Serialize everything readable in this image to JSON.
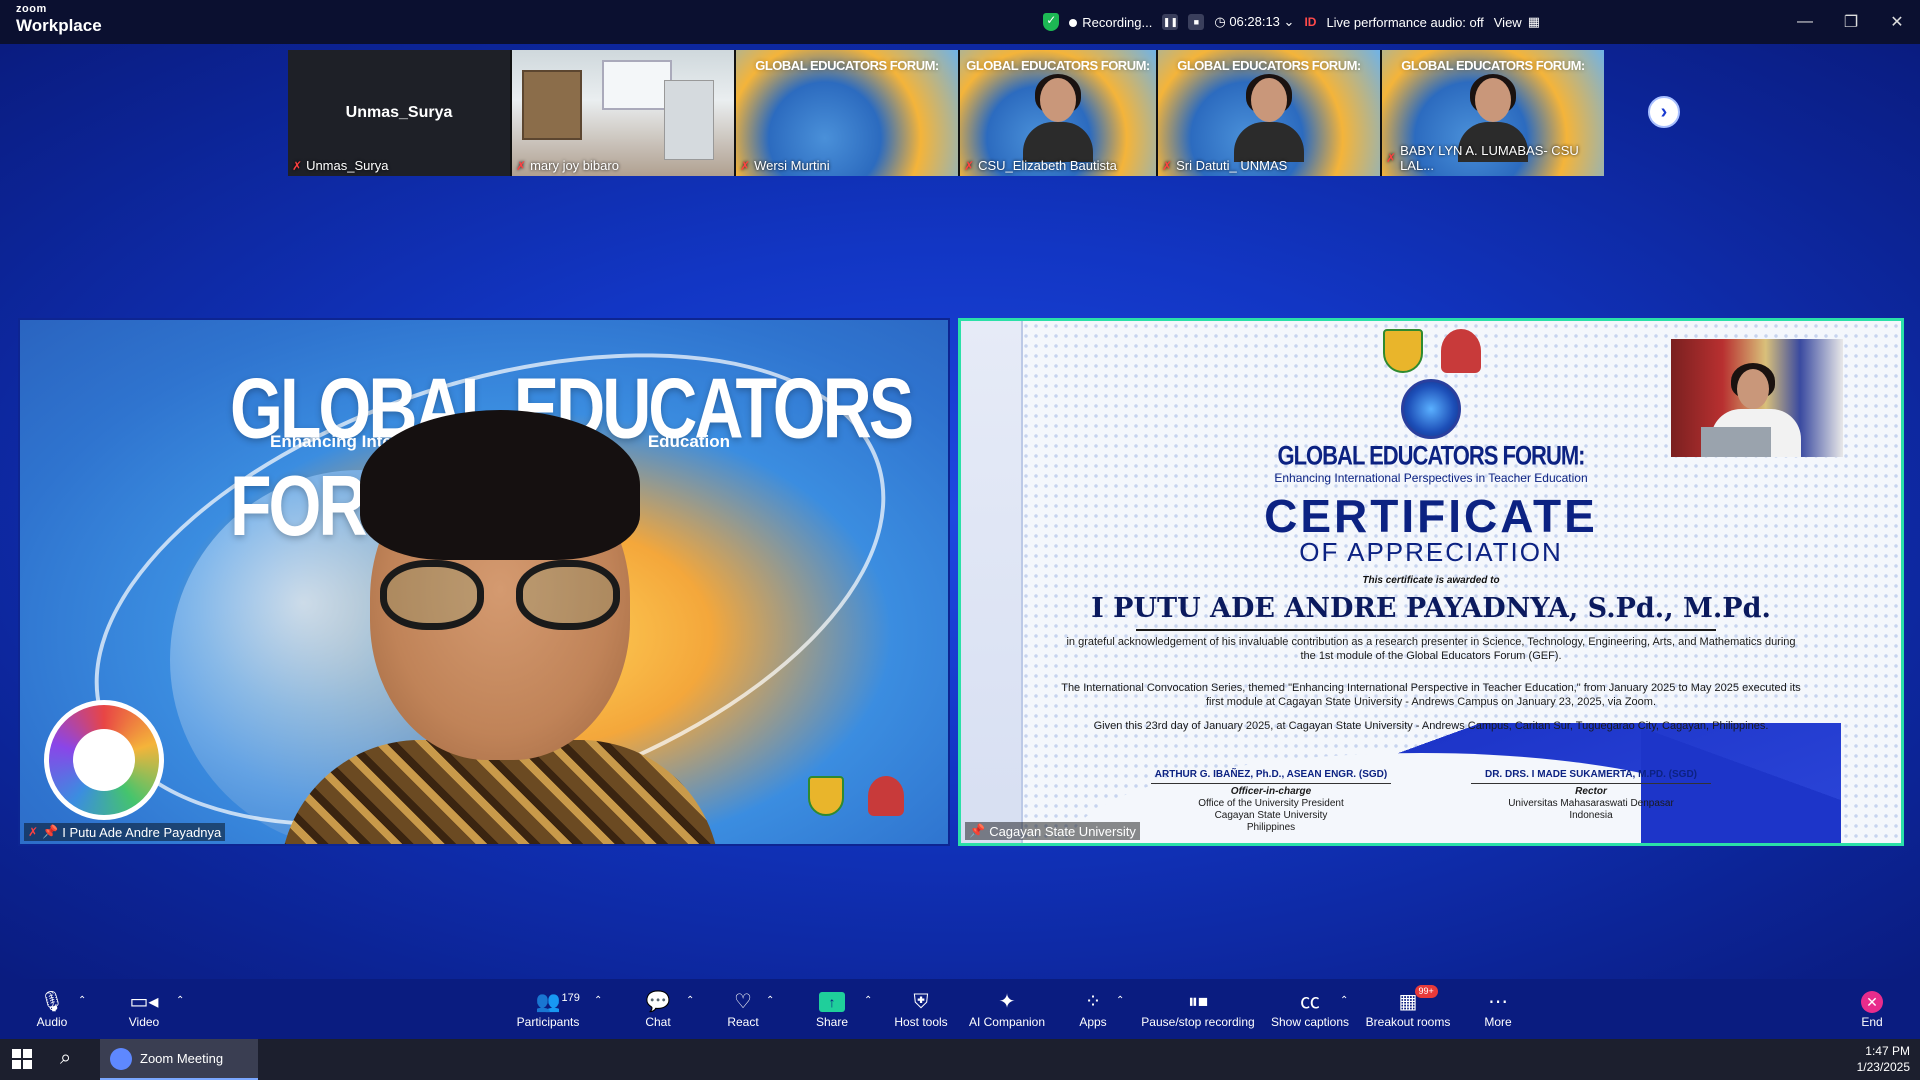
{
  "titlebar": {
    "brand_small": "zoom",
    "brand_large": "Workplace",
    "recording_label": "Recording...",
    "timer": "06:28:13",
    "id_badge": "ID",
    "live_audio": "Live performance audio: off",
    "view_label": "View"
  },
  "thumbnails": [
    {
      "name": "Unmas_Surya",
      "center_name": "Unmas_Surya"
    },
    {
      "name": "mary joy bibaro"
    },
    {
      "name": "Wersi Murtini",
      "overlay": "GLOBAL EDUCATORS FORUM:"
    },
    {
      "name": "CSU_Elizabeth Bautista",
      "overlay": "GLOBAL EDUCATORS FORUM:"
    },
    {
      "name": "Sri Datuti_ UNMAS",
      "overlay": "GLOBAL EDUCATORS FORUM:"
    },
    {
      "name": "BABY LYN A. LUMABAS- CSU LAL...",
      "overlay": "GLOBAL EDUCATORS FORUM:"
    }
  ],
  "speaker_tile": {
    "title": "GLOBAL EDUCATORS FORUM:",
    "subtitle_left": "Enhancing Intern",
    "subtitle_right": "Education",
    "name": "I Putu Ade Andre Payadnya"
  },
  "share_tile": {
    "name": "Cagayan State University",
    "certificate": {
      "forum_title": "GLOBAL EDUCATORS FORUM:",
      "forum_subtitle": "Enhancing International Perspectives in Teacher Education",
      "heading": "CERTIFICATE",
      "subheading": "OF APPRECIATION",
      "awarded_to": "This certificate is awarded to",
      "recipient": "I PUTU ADE ANDRE PAYADNYA, S.Pd., M.Pd.",
      "para1": "in grateful acknowledgement of his invaluable contribution as a research presenter in Science, Technology, Engineering, Arts, and Mathematics during the 1st module of the Global Educators Forum (GEF).",
      "para2": "The International Convocation Series, themed \"Enhancing International Perspective in Teacher Education,\" from January 2025 to May 2025 executed its first module at Cagayan State University - Andrews Campus on January 23, 2025, via Zoom.",
      "para3": "Given this 23rd day of January 2025, at Cagayan State University - Andrews Campus, Caritan Sur, Tuguegarao City, Cagayan, Philippines.",
      "signatory_left": {
        "name": "ARTHUR G. IBAÑEZ, Ph.D., ASEAN ENGR. (SGD)",
        "role": "Officer-in-charge",
        "line1": "Office of the University President",
        "line2": "Cagayan State University",
        "line3": "Philippines"
      },
      "signatory_right": {
        "name": "DR. DRS. I MADE SUKAMERTA, M.PD. (SGD)",
        "role": "Rector",
        "line1": "Universitas Mahasaraswati Denpasar",
        "line2": "Indonesia"
      }
    }
  },
  "toolbar": {
    "audio": "Audio",
    "video": "Video",
    "participants": "Participants",
    "participants_count": "179",
    "chat": "Chat",
    "react": "React",
    "share": "Share",
    "host_tools": "Host tools",
    "ai_companion": "AI Companion",
    "apps": "Apps",
    "pause_recording": "Pause/stop recording",
    "show_captions": "Show captions",
    "breakout_rooms": "Breakout rooms",
    "breakout_badge": "99+",
    "more": "More",
    "end": "End"
  },
  "taskbar": {
    "app_label": "Zoom Meeting",
    "time": "1:47 PM",
    "date": "1/23/2025"
  },
  "colors": {
    "stage_blue": "#1236c4",
    "toolbar_bg": "#0a1c80",
    "active_border": "#2be0a8",
    "share_green": "#1fcf9b",
    "end_pink": "#e82c8c"
  }
}
